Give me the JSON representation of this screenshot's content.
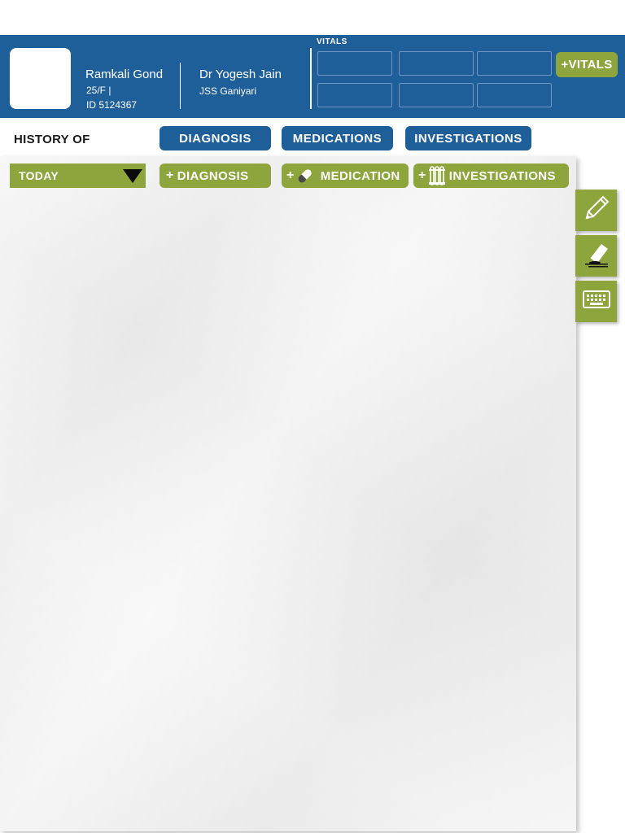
{
  "patient": {
    "name": "Ramkali Gond",
    "age_sex": "25/F  |",
    "id": "ID 5124367"
  },
  "doctor": {
    "name": "Dr Yogesh Jain",
    "org": "JSS Ganiyari"
  },
  "vitals": {
    "label": "VITALS",
    "add_label": "+VITALS"
  },
  "history": {
    "label": "HISTORY OF",
    "tabs": [
      "DIAGNOSIS",
      "MEDICATIONS",
      "INVESTIGATIONS"
    ]
  },
  "entry": {
    "period": "TODAY",
    "add_diagnosis": "DIAGNOSIS",
    "add_medication": "MEDICATION",
    "add_investigations": "INVESTIGATIONS",
    "plus": "+"
  },
  "tools": [
    "pencil-icon",
    "eraser-icon",
    "keyboard-icon"
  ],
  "colors": {
    "header_blue": "#1f5f99",
    "accent_green": "#8ea53d"
  }
}
